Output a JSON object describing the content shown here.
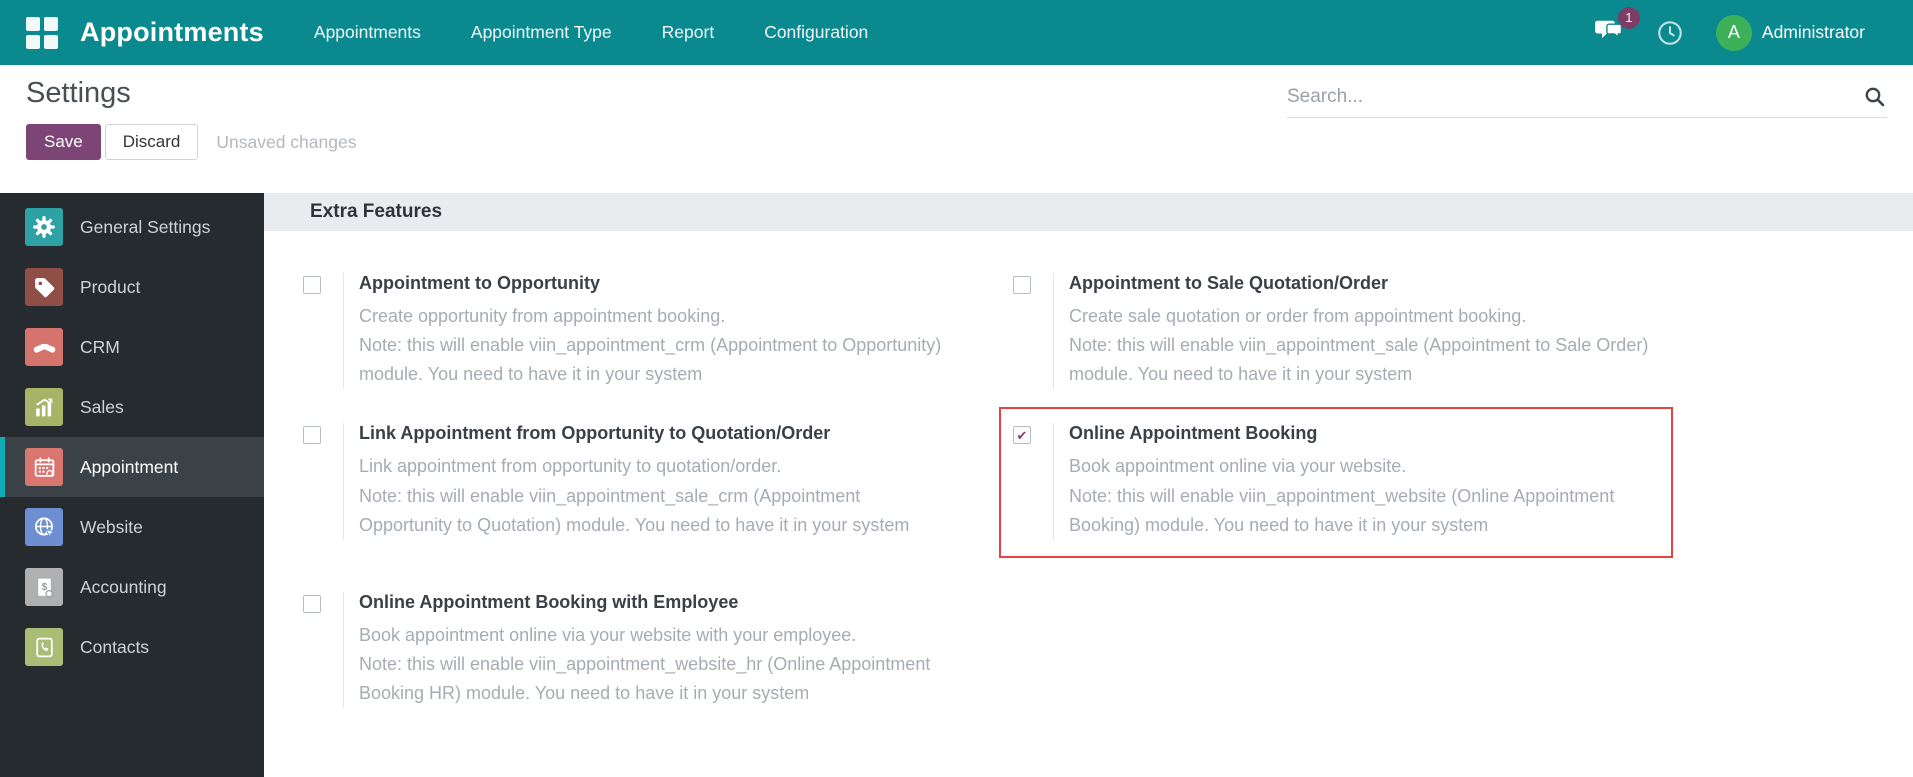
{
  "topbar": {
    "brand": "Appointments",
    "menu": [
      {
        "label": "Appointments"
      },
      {
        "label": "Appointment Type"
      },
      {
        "label": "Report"
      },
      {
        "label": "Configuration"
      }
    ],
    "messages_badge": "1",
    "user": {
      "initial": "A",
      "name": "Administrator"
    }
  },
  "control_panel": {
    "title": "Settings",
    "search_placeholder": "Search...",
    "save_label": "Save",
    "discard_label": "Discard",
    "unsaved_label": "Unsaved changes"
  },
  "sidebar": {
    "items": [
      {
        "label": "General Settings",
        "selected": false
      },
      {
        "label": "Product",
        "selected": false
      },
      {
        "label": "CRM",
        "selected": false
      },
      {
        "label": "Sales",
        "selected": false
      },
      {
        "label": "Appointment",
        "selected": true
      },
      {
        "label": "Website",
        "selected": false
      },
      {
        "label": "Accounting",
        "selected": false
      },
      {
        "label": "Contacts",
        "selected": false
      }
    ]
  },
  "main": {
    "section_title": "Extra Features",
    "settings": [
      {
        "title": "Appointment to Opportunity",
        "desc": "Create opportunity from appointment booking.",
        "note": "Note: this will enable viin_appointment_crm (Appointment to Opportunity) module. You need to have it in your system",
        "checked": false,
        "highlighted": false
      },
      {
        "title": "Appointment to Sale Quotation/Order",
        "desc": "Create sale quotation or order from appointment booking.",
        "note": "Note: this will enable viin_appointment_sale (Appointment to Sale Order) module. You need to have it in your system",
        "checked": false,
        "highlighted": false
      },
      {
        "title": "Link Appointment from Opportunity to Quotation/Order",
        "desc": "Link appointment from opportunity to quotation/order.",
        "note": "Note: this will enable viin_appointment_sale_crm (Appointment Opportunity to Quotation) module. You need to have it in your system",
        "checked": false,
        "highlighted": false
      },
      {
        "title": "Online Appointment Booking",
        "desc": "Book appointment online via your website.",
        "note": "Note: this will enable viin_appointment_website (Online Appointment Booking) module. You need to have it in your system",
        "checked": true,
        "highlighted": true
      },
      {
        "title": "Online Appointment Booking with Employee",
        "desc": "Book appointment online via your website with your employee.",
        "note": "Note: this will enable viin_appointment_website_hr (Online Appointment Booking HR) module. You need to have it in your system",
        "checked": false,
        "highlighted": false
      }
    ]
  },
  "colors": {
    "topbar": "#0a8a8f",
    "primary_button": "#7c4576",
    "badge": "#7d3e66",
    "avatar": "#3db15a",
    "sidebar_bg": "#262b30",
    "sidebar_selected_bg": "#3a4147",
    "sidebar_selected_accent": "#12aab5",
    "section_band_bg": "#e9ecef",
    "highlight_border": "#e5433e",
    "checkmark": "#7a4171",
    "icon_general_settings": "#2da2a5",
    "icon_product": "#8f4f47",
    "icon_crm": "#d4746d",
    "icon_sales": "#a7b467",
    "icon_appointment": "#d9766f",
    "icon_website": "#6d8fd2",
    "icon_accounting": "#aeb0b2",
    "icon_contacts": "#a9bd77"
  }
}
